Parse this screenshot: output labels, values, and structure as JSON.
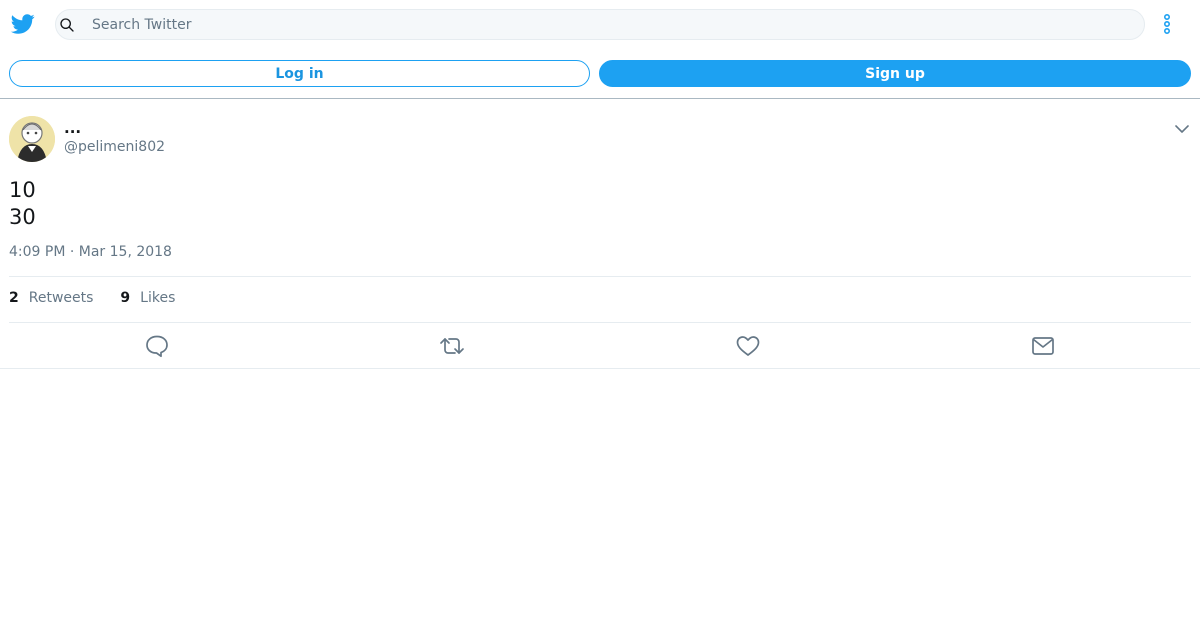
{
  "header": {
    "search_placeholder": "Search Twitter",
    "icons": {
      "logo": "twitter-bird-icon",
      "search": "search-icon",
      "more": "more-vertical-icon"
    },
    "accent": "#1da1f2"
  },
  "auth": {
    "login_label": "Log in",
    "signup_label": "Sign up"
  },
  "tweet": {
    "display_name": "...",
    "handle": "@pelimeni802",
    "lines": [
      "10",
      "30"
    ],
    "timestamp": "4:09 PM · Mar 15, 2018",
    "stats": {
      "retweets_count": "2",
      "retweets_label": "Retweets",
      "likes_count": "9",
      "likes_label": "Likes"
    }
  },
  "actions": [
    "reply-icon",
    "retweet-icon",
    "like-icon",
    "direct-message-icon"
  ]
}
